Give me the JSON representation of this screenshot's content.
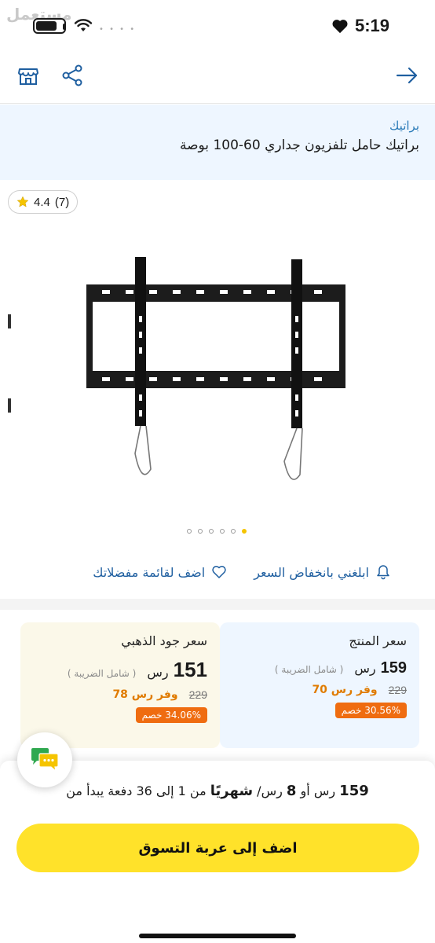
{
  "status_bar": {
    "time": "5:19",
    "watermark": "مستعمل",
    "battery_level": 0.75
  },
  "header": {
    "brand": "براتيك",
    "product_title": "براتيك حامل تلفزيون جداري 60-100 بوصة"
  },
  "gallery": {
    "rating": "4.4",
    "review_count": "(7)",
    "slides": 6,
    "active_slide": 6
  },
  "actions": {
    "price_alert_label": "ابلغني بانخفاض السعر",
    "wishlist_label": "اضف لقائمة مفضلاتك"
  },
  "price_cards": {
    "regular": {
      "title": "سعر المنتج",
      "price": "159",
      "currency": "رس",
      "tax_note": "( شامل الضريبة )",
      "old_price": "229",
      "save_text": "وفر رس 70",
      "discount": "30.56% خصم"
    },
    "gold": {
      "title": "سعر جود الذهبي",
      "price": "151",
      "currency": "رس",
      "tax_note": "( شامل الضريبة )",
      "old_price": "229",
      "save_text": "وفر رس 78",
      "discount": "34.06% خصم"
    }
  },
  "bottom_sheet": {
    "installment_amount": "159",
    "installment_currency": "رس",
    "installment_or": "أو",
    "installment_monthly": "8",
    "installment_monthly_unit": "رس/",
    "installment_monthly_word": "شهريًا",
    "installment_rest": "من 1 إلى 36 دفعة  يبدأ من",
    "cart_button_label": "اضف إلى عربة التسوق"
  },
  "colors": {
    "accent_yellow": "#ffe22a",
    "link_blue": "#1f5fa0",
    "discount_orange": "#ef6c10"
  }
}
